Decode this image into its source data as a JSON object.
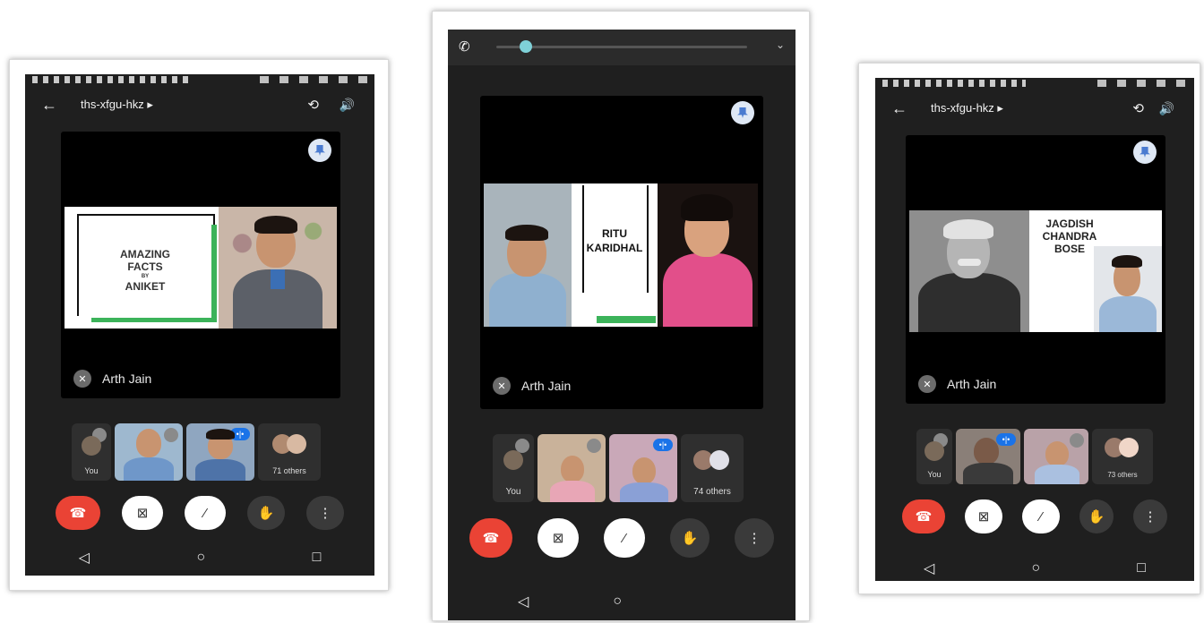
{
  "meeting_code": "ths-xfgu-hkz ▸",
  "pinned_name": "Arth Jain",
  "self_label": "You",
  "phones": [
    {
      "slide_text": [
        "AMAZING",
        "FACTS",
        "BY",
        "ANIKET"
      ],
      "others_count": "71 others"
    },
    {
      "slide_text": [
        "RITU",
        "KARIDHAL"
      ],
      "others_count": "74 others"
    },
    {
      "slide_text": [
        "JAGDISH",
        "CHANDRA",
        "BOSE"
      ],
      "others_count": "73 others"
    }
  ],
  "icons": {
    "back": "arrow-left-icon",
    "camera_switch": "camera-switch-icon",
    "speaker": "speaker-icon",
    "pin": "pin-icon",
    "mic_off": "mic-off-icon",
    "end_call": "end-call-icon",
    "camera_off": "camera-off-icon",
    "raise_hand": "raise-hand-icon",
    "more": "more-vertical-icon",
    "phone": "phone-icon",
    "nav_back": "nav-back-icon",
    "nav_home": "nav-home-icon",
    "nav_recents": "nav-recents-icon"
  },
  "colors": {
    "end_call": "#ea4335",
    "speaking": "#1a73e8",
    "slide_accent": "#3cb35a"
  }
}
